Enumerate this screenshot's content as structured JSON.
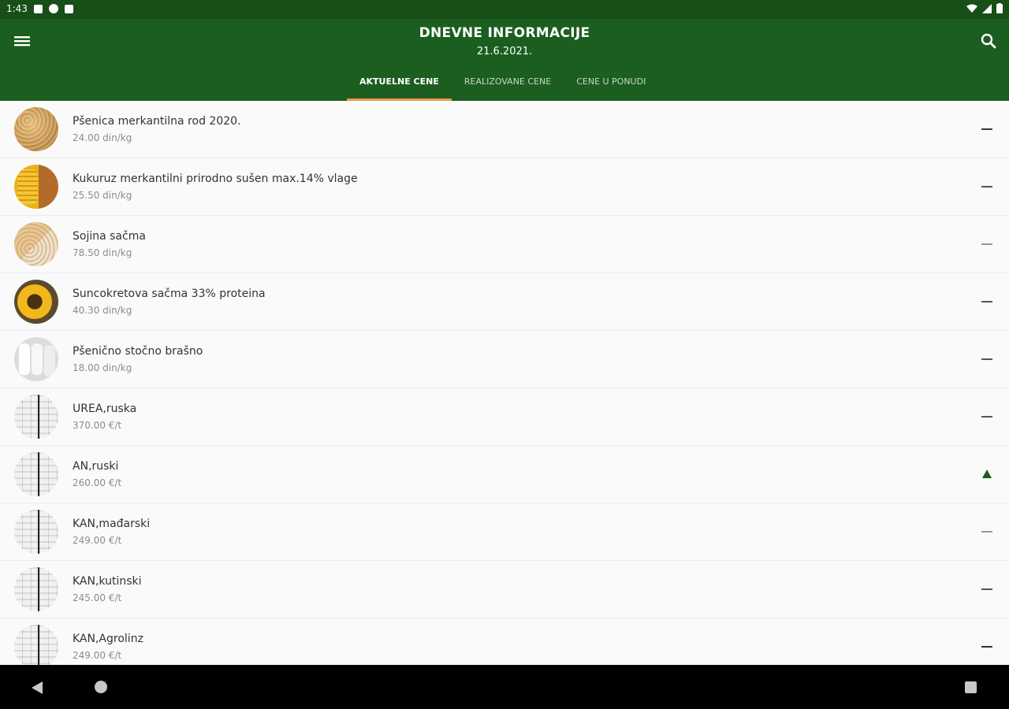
{
  "status_bar": {
    "time": "1:43"
  },
  "header": {
    "title": "DNEVNE INFORMACIJE",
    "date": "21.6.2021."
  },
  "tabs": [
    {
      "label": "AKTUELNE CENE",
      "active": true
    },
    {
      "label": "REALIZOVANE CENE",
      "active": false
    },
    {
      "label": "CENE U PONUDI",
      "active": false
    }
  ],
  "accent_color": "#1b5e1f",
  "items": [
    {
      "name": "Pšenica merkantilna rod 2020.",
      "price": "24.00 din/kg",
      "image": "wheat",
      "trend": "unchanged"
    },
    {
      "name": "Kukuruz merkantilni prirodno sušen max.14% vlage",
      "price": "25.50 din/kg",
      "image": "corn",
      "trend": "unchanged"
    },
    {
      "name": "Sojina sačma",
      "price": "78.50 din/kg",
      "image": "soy",
      "trend": "unchanged"
    },
    {
      "name": "Suncokretova sačma 33% proteina",
      "price": "40.30 din/kg",
      "image": "sunflower",
      "trend": "unchanged"
    },
    {
      "name": "Pšenično stočno brašno",
      "price": "18.00 din/kg",
      "image": "flour",
      "trend": "unchanged"
    },
    {
      "name": "UREA,ruska",
      "price": "370.00 €/t",
      "image": "fertilizer-bags",
      "trend": "unchanged"
    },
    {
      "name": "AN,ruski",
      "price": "260.00 €/t",
      "image": "fertilizer-bags",
      "trend": "up"
    },
    {
      "name": "KAN,mađarski",
      "price": "249.00 €/t",
      "image": "fertilizer-bags",
      "trend": "unchanged"
    },
    {
      "name": "KAN,kutinski",
      "price": "245.00 €/t",
      "image": "fertilizer-bags",
      "trend": "unchanged"
    },
    {
      "name": "KAN,Agrolinz",
      "price": "249.00 €/t",
      "image": "fertilizer-bags",
      "trend": "unchanged"
    }
  ]
}
